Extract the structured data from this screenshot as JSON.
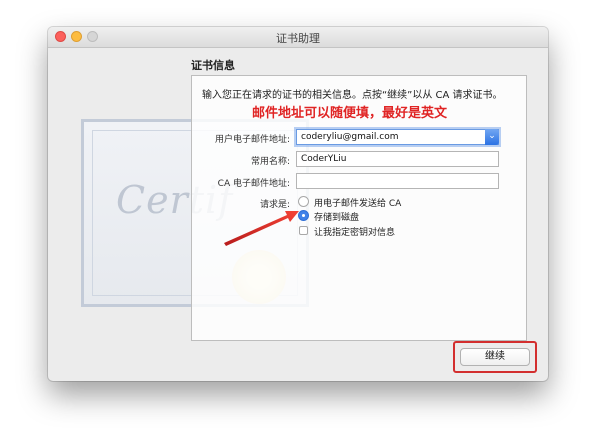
{
  "window": {
    "title": "证书助理"
  },
  "certificate_art": {
    "script_text": "Certif"
  },
  "section": {
    "title": "证书信息"
  },
  "form": {
    "intro": "输入您正在请求的证书的相关信息。点按“继续”以从 CA 请求证书。",
    "annotation": "邮件地址可以随便填，最好是英文",
    "annotation_color": "#e02424",
    "email_label": "用户电子邮件地址:",
    "email_value": "coderyliu@gmail.com",
    "common_name_label": "常用名称:",
    "common_name_value": "CoderYLiu",
    "ca_email_label": "CA 电子邮件地址:",
    "ca_email_value": "",
    "request_label": "请求是:",
    "options": [
      {
        "label": "用电子邮件发送给 CA",
        "selected": false
      },
      {
        "label": "存储到磁盘",
        "selected": true
      }
    ],
    "key_pair_checkbox": {
      "label": "让我指定密钥对信息",
      "checked": false
    }
  },
  "footer": {
    "continue_label": "继续"
  },
  "colors": {
    "highlight": "#d32f2f",
    "accent": "#3f81e8"
  },
  "icons": {
    "dropdown": "chevron-down-icon",
    "traffic_lights": [
      "close-icon",
      "minimize-icon",
      "zoom-icon"
    ]
  }
}
